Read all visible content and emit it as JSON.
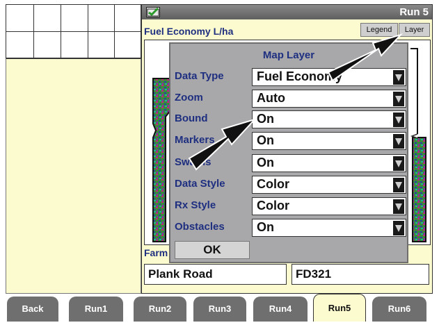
{
  "header": {
    "run_label": "Run 5"
  },
  "main": {
    "title": "Fuel Economy L/ha",
    "legend_button": "Legend",
    "layer_button": "Layer",
    "farm_label": "Farm",
    "farm_value": "Plank Road",
    "field_value": "FD321"
  },
  "popup": {
    "title": "Map Layer",
    "options": [
      {
        "label": "Data Type",
        "value": "Fuel Economy"
      },
      {
        "label": "Zoom",
        "value": "Auto"
      },
      {
        "label": "Bound",
        "value": "On"
      },
      {
        "label": "Markers",
        "value": "On"
      },
      {
        "label": "Swaths",
        "value": "On"
      },
      {
        "label": "Data Style",
        "value": "Color"
      },
      {
        "label": "Rx Style",
        "value": "Color"
      },
      {
        "label": "Obstacles",
        "value": "On"
      }
    ],
    "ok_label": "OK"
  },
  "tabs": [
    "Back",
    "Run1",
    "Run2",
    "Run3",
    "Run4",
    "Run5",
    "Run6"
  ],
  "active_tab": "Run5",
  "colors": {
    "panel": "#fbfbcf",
    "header": "#6e6e6e",
    "label_blue": "#1f2f80",
    "popup": "#a8a8ab",
    "tab": "#6f6f6f"
  },
  "icons": [
    "status-check-icon",
    "dropdown-arrow-icon",
    "pointer-arrow-icon"
  ]
}
